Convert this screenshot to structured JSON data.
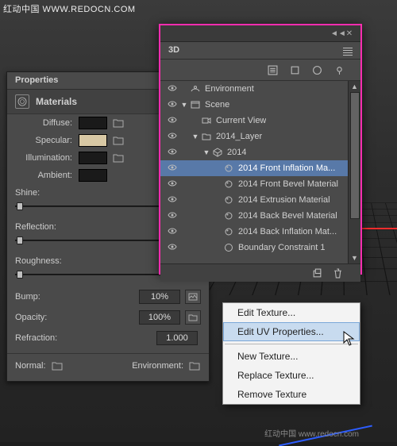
{
  "watermark": {
    "top": "红动中国 WWW.REDOCN.COM",
    "bottom": "红动中国 www.redocn.com"
  },
  "props_panel": {
    "tab": "Properties",
    "section": "Materials",
    "rows": {
      "diffuse": {
        "label": "Diffuse:",
        "swatch": "#1a1a1a"
      },
      "specular": {
        "label": "Specular:",
        "swatch": "#d8c8a4"
      },
      "illumination": {
        "label": "Illumination:",
        "swatch": "#1a1a1a"
      },
      "ambient": {
        "label": "Ambient:",
        "swatch": "#1a1a1a"
      }
    },
    "sliders": {
      "shine": {
        "label": "Shine:",
        "pos": 2
      },
      "reflection": {
        "label": "Reflection:",
        "pos": 2
      },
      "roughness": {
        "label": "Roughness:",
        "pos": 2
      }
    },
    "values": {
      "bump": {
        "label": "Bump:",
        "value": "10%"
      },
      "opacity": {
        "label": "Opacity:",
        "value": "100%"
      },
      "refraction": {
        "label": "Refraction:",
        "value": "1.000"
      }
    },
    "bottom": {
      "normal": "Normal:",
      "environment": "Environment:"
    }
  },
  "panel3d": {
    "title": "3D",
    "tree": [
      {
        "label": "Environment",
        "indent": 0,
        "icon": "env",
        "twisty": ""
      },
      {
        "label": "Scene",
        "indent": 0,
        "icon": "scene",
        "twisty": "▼"
      },
      {
        "label": "Current View",
        "indent": 1,
        "icon": "camera",
        "twisty": ""
      },
      {
        "label": "2014_Layer",
        "indent": 1,
        "icon": "folder",
        "twisty": "▼"
      },
      {
        "label": "2014",
        "indent": 2,
        "icon": "mesh",
        "twisty": "▼"
      },
      {
        "label": "2014 Front Inflation Ma...",
        "indent": 3,
        "icon": "mat",
        "twisty": "",
        "sel": true
      },
      {
        "label": "2014 Front Bevel Material",
        "indent": 3,
        "icon": "mat",
        "twisty": ""
      },
      {
        "label": "2014 Extrusion Material",
        "indent": 3,
        "icon": "mat",
        "twisty": ""
      },
      {
        "label": "2014 Back Bevel Material",
        "indent": 3,
        "icon": "mat",
        "twisty": ""
      },
      {
        "label": "2014 Back Inflation Mat...",
        "indent": 3,
        "icon": "mat",
        "twisty": ""
      },
      {
        "label": "Boundary Constraint 1",
        "indent": 3,
        "icon": "bound",
        "twisty": ""
      }
    ]
  },
  "context_menu": {
    "items": [
      {
        "label": "Edit Texture..."
      },
      {
        "label": "Edit UV Properties...",
        "hover": true
      }
    ],
    "items2": [
      {
        "label": "New Texture..."
      },
      {
        "label": "Replace Texture..."
      },
      {
        "label": "Remove Texture"
      }
    ]
  }
}
